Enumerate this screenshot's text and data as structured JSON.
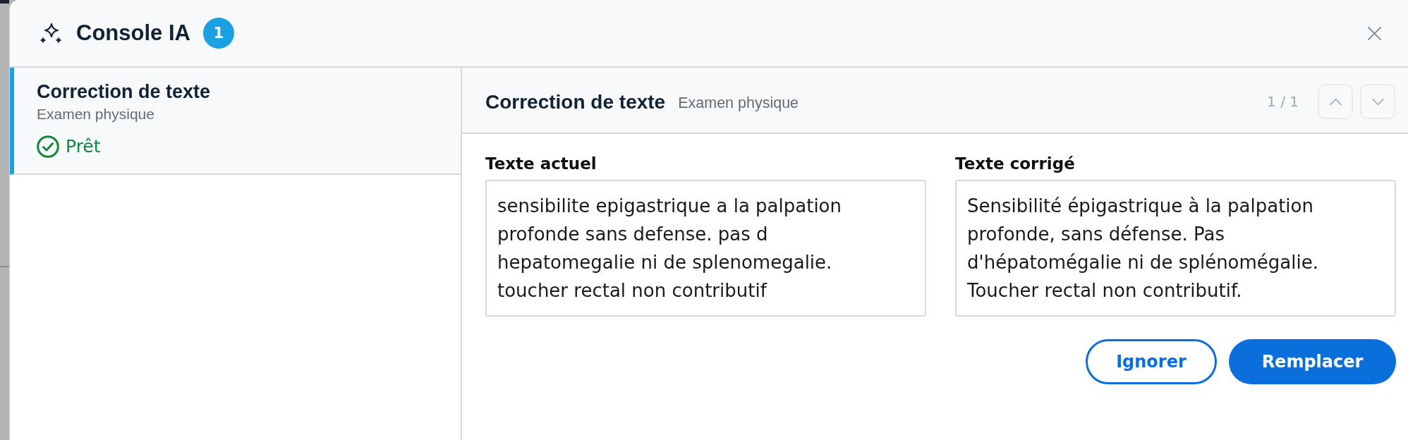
{
  "header": {
    "title": "Console IA",
    "badge": "1"
  },
  "sidebar": {
    "items": [
      {
        "title": "Correction de texte",
        "subtitle": "Examen physique",
        "status": {
          "label": "Prêt",
          "kind": "ready"
        },
        "selected": true
      }
    ]
  },
  "detail": {
    "title": "Correction de texte",
    "subtitle": "Examen physique",
    "counter": "1 / 1",
    "nav": [
      {
        "kind": "up",
        "disabled": true
      },
      {
        "kind": "down",
        "disabled": true
      }
    ]
  },
  "fields": [
    {
      "label": "Texte actuel",
      "value": "sensibilite epigastrique a la palpation profonde sans defense. pas d hepatomegalie ni de splenomegalie. toucher rectal non contributif"
    },
    {
      "label": "Texte corrigé",
      "value": "Sensibilité épigastrique à la palpation profonde, sans défense. Pas d'hépatomégalie ni de splénomégalie. Toucher rectal non contributif."
    }
  ],
  "buttons": [
    {
      "label": "Ignorer",
      "kind": "outline"
    },
    {
      "label": "Remplacer",
      "kind": "primary"
    }
  ]
}
